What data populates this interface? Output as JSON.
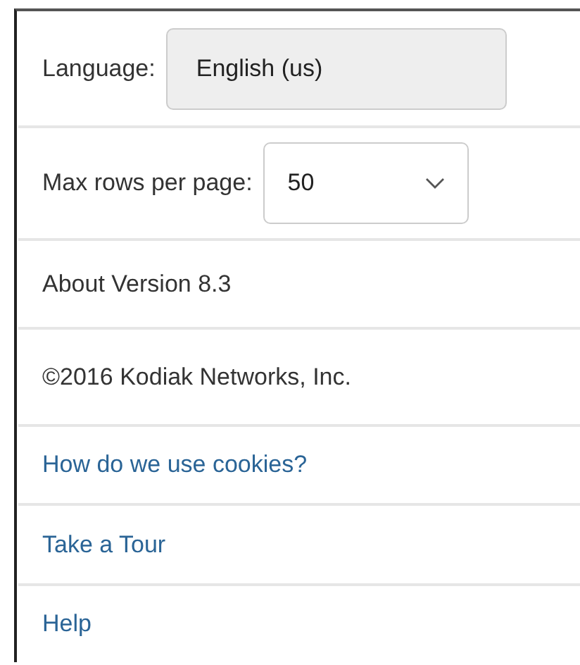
{
  "language": {
    "label": "Language:",
    "value": "English (us)",
    "disabled": true
  },
  "max_rows": {
    "label": "Max rows per page:",
    "value": "50"
  },
  "items": [
    {
      "kind": "text",
      "text": "About Version 8.3"
    },
    {
      "kind": "text",
      "text": "©2016 Kodiak Networks, Inc."
    },
    {
      "kind": "link",
      "text": "How do we use cookies?"
    },
    {
      "kind": "link",
      "text": "Take a Tour"
    },
    {
      "kind": "link",
      "text": "Help"
    }
  ]
}
